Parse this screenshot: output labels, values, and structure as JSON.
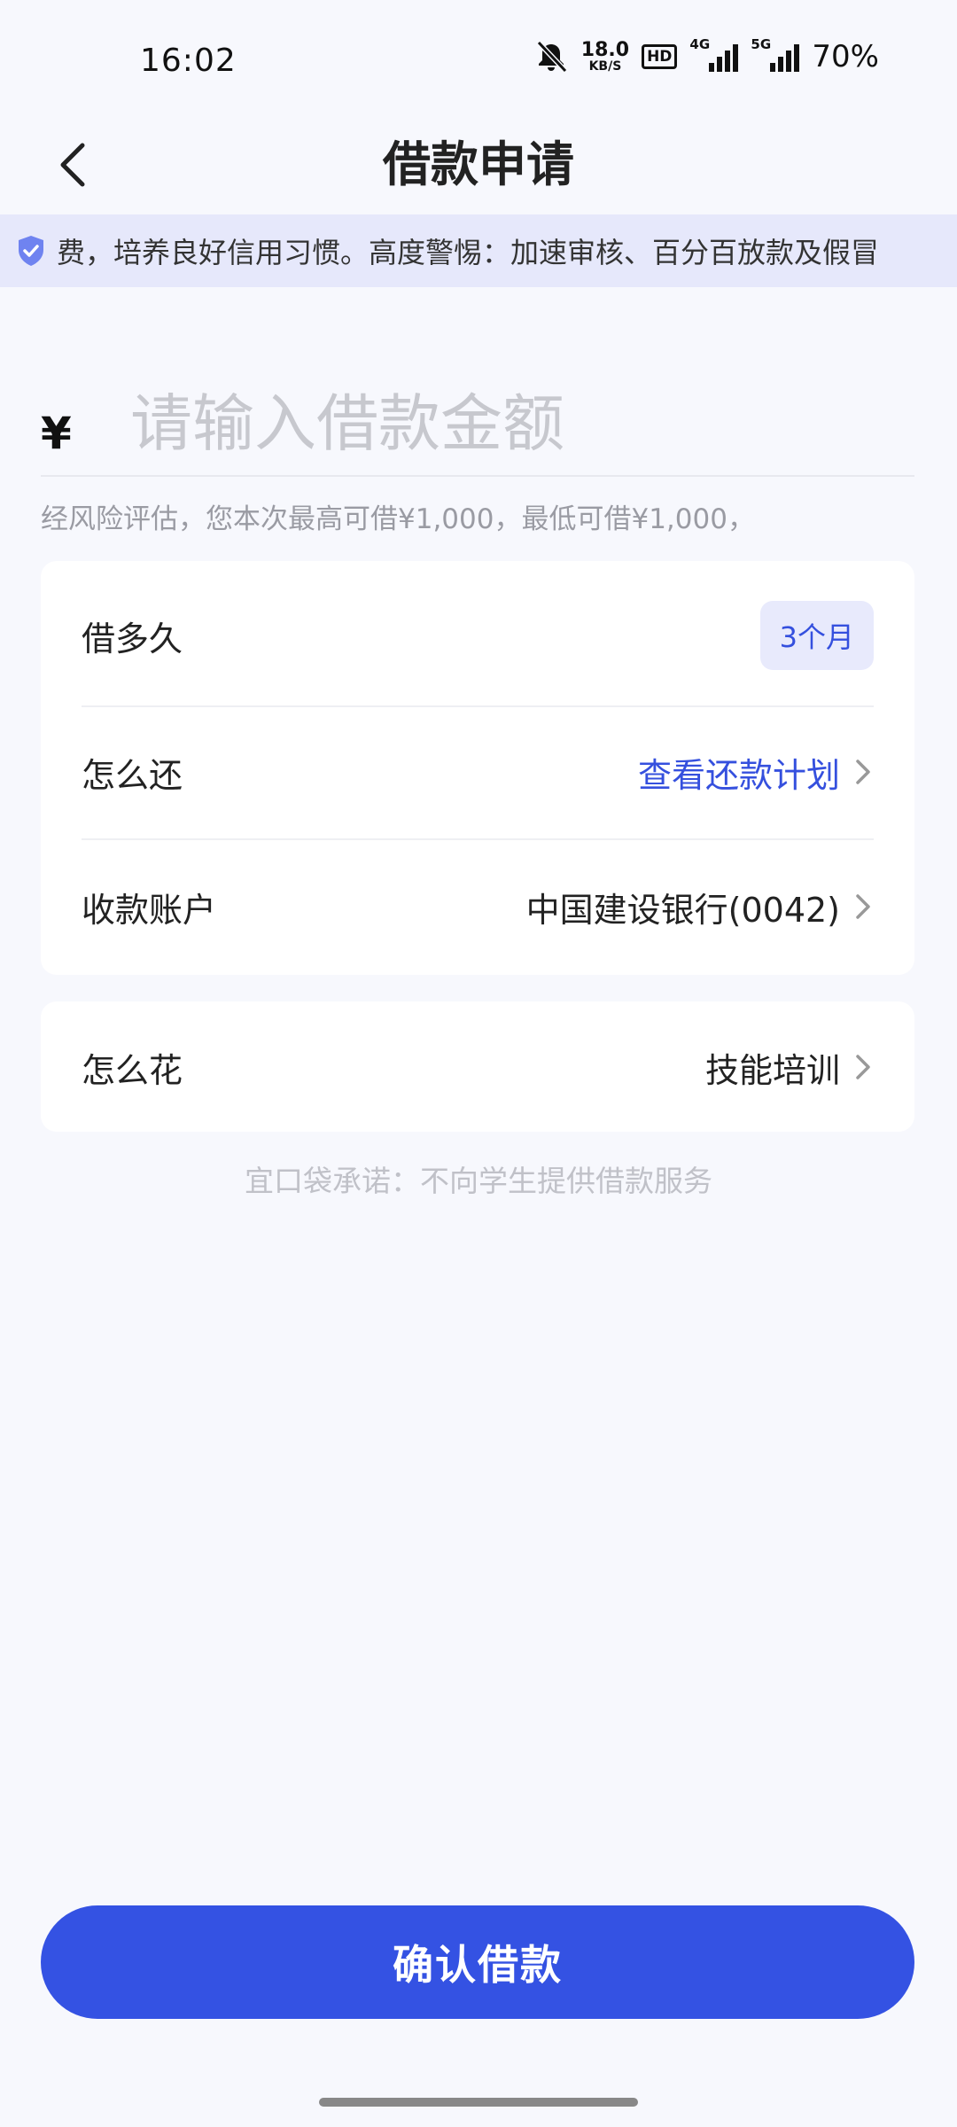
{
  "status_bar": {
    "time": "16:02",
    "net_speed_value": "18.0",
    "net_speed_unit": "KB/S",
    "hd_badge": "HD",
    "signal1_label": "4G",
    "signal2_label": "5G",
    "battery": "70%"
  },
  "header": {
    "title": "借款申请",
    "back_icon": "chevron-left-icon"
  },
  "notice": {
    "icon": "shield-check-icon",
    "text": "费，培养良好信用习惯。高度警惕：加速审核、百分百放款及假冒"
  },
  "amount": {
    "currency_symbol": "¥",
    "placeholder": "请输入借款金额",
    "value": ""
  },
  "hint": "经风险评估，您本次最高可借¥1,000，最低可借¥1,000，",
  "loan_card": {
    "term": {
      "label": "借多久",
      "value": "3个月"
    },
    "repay": {
      "label": "怎么还",
      "value": "查看还款计划"
    },
    "account": {
      "label": "收款账户",
      "value": "中国建设银行(0042)"
    }
  },
  "usage_card": {
    "usage": {
      "label": "怎么花",
      "value": "技能培训"
    }
  },
  "promise": "宜口袋承诺：不向学生提供借款服务",
  "confirm_button": "确认借款",
  "colors": {
    "accent": "#3452e3",
    "link_blue": "#3550de",
    "notice_bg": "#e6e8fb",
    "page_bg": "#f7f8fd"
  }
}
